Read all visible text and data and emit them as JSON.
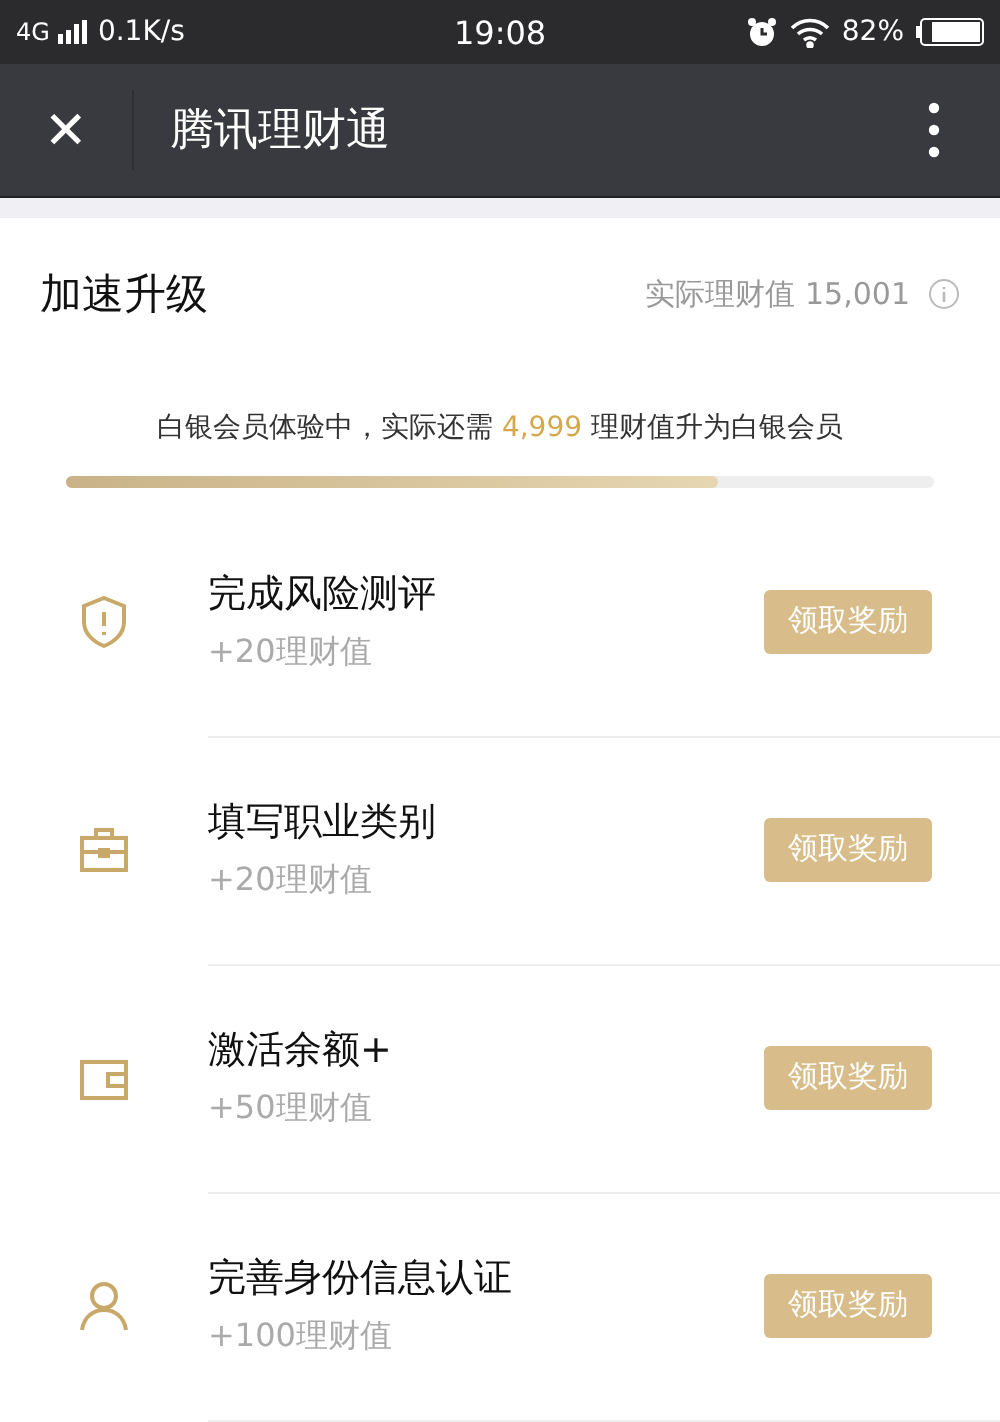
{
  "status_bar": {
    "network": "4G",
    "speed": "0.1K/s",
    "time": "19:08",
    "battery": "82%"
  },
  "nav": {
    "close": "✕",
    "title": "腾讯理财通"
  },
  "header": {
    "title": "加速升级",
    "value_label": "实际理财值 15,001"
  },
  "progress": {
    "text": "白银会员体验中，实际还需 **4,999** 理财值升为白银会员",
    "level": 0.75
  },
  "tasks": [
    {
      "kind": "shield",
      "title": "完成风险测评",
      "reward": "+20理财值",
      "button": "领取奖励"
    },
    {
      "kind": "briefcase",
      "title": "填写职业类别",
      "reward": "+20理财值",
      "button": "领取奖励"
    },
    {
      "kind": "wallet",
      "title": "激活余额+",
      "reward": "+50理财值",
      "button": "领取奖励"
    },
    {
      "kind": "person",
      "title": "完善身份信息认证",
      "reward": "+100理财值",
      "button": "领取奖励"
    }
  ]
}
